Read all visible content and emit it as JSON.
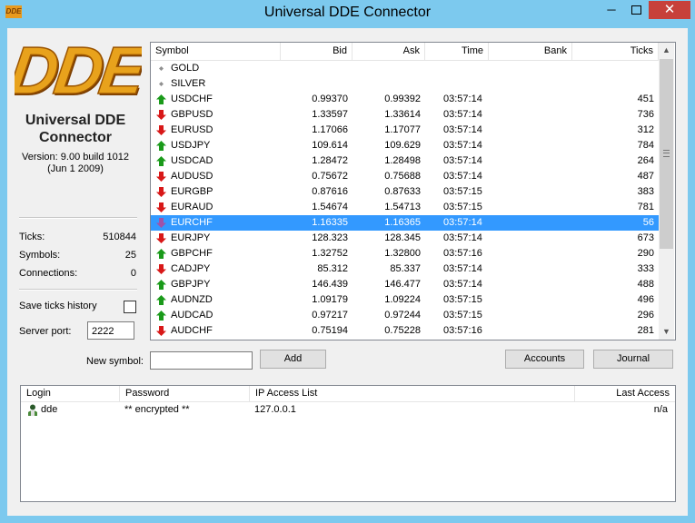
{
  "window": {
    "title": "Universal DDE Connector",
    "icon_text": "DDE",
    "min": "─",
    "close": "✕"
  },
  "logo": {
    "text": "DDE",
    "color": "#e8a21c"
  },
  "app": {
    "name_line1": "Universal DDE",
    "name_line2": "Connector",
    "version_line1": "Version: 9.00 build 1012",
    "version_line2": "(Jun  1 2009)"
  },
  "stats": {
    "ticks_label": "Ticks:",
    "ticks_value": "510844",
    "symbols_label": "Symbols:",
    "symbols_value": "25",
    "connections_label": "Connections:",
    "connections_value": "0"
  },
  "settings": {
    "save_history_label": "Save ticks history",
    "server_port_label": "Server port:",
    "server_port_value": "2222"
  },
  "symbols_table": {
    "columns": [
      "Symbol",
      "Bid",
      "Ask",
      "Time",
      "Bank",
      "Ticks"
    ],
    "rows": [
      {
        "dir": "none",
        "symbol": "GOLD",
        "bid": "",
        "ask": "",
        "time": "",
        "bank": "",
        "ticks": ""
      },
      {
        "dir": "none",
        "symbol": "SILVER",
        "bid": "",
        "ask": "",
        "time": "",
        "bank": "",
        "ticks": ""
      },
      {
        "dir": "up",
        "symbol": "USDCHF",
        "bid": "0.99370",
        "ask": "0.99392",
        "time": "03:57:14",
        "bank": "",
        "ticks": "451"
      },
      {
        "dir": "down",
        "symbol": "GBPUSD",
        "bid": "1.33597",
        "ask": "1.33614",
        "time": "03:57:14",
        "bank": "",
        "ticks": "736"
      },
      {
        "dir": "down",
        "symbol": "EURUSD",
        "bid": "1.17066",
        "ask": "1.17077",
        "time": "03:57:14",
        "bank": "",
        "ticks": "312"
      },
      {
        "dir": "up",
        "symbol": "USDJPY",
        "bid": "109.614",
        "ask": "109.629",
        "time": "03:57:14",
        "bank": "",
        "ticks": "784"
      },
      {
        "dir": "up",
        "symbol": "USDCAD",
        "bid": "1.28472",
        "ask": "1.28498",
        "time": "03:57:14",
        "bank": "",
        "ticks": "264"
      },
      {
        "dir": "down",
        "symbol": "AUDUSD",
        "bid": "0.75672",
        "ask": "0.75688",
        "time": "03:57:14",
        "bank": "",
        "ticks": "487"
      },
      {
        "dir": "down",
        "symbol": "EURGBP",
        "bid": "0.87616",
        "ask": "0.87633",
        "time": "03:57:15",
        "bank": "",
        "ticks": "383"
      },
      {
        "dir": "down",
        "symbol": "EURAUD",
        "bid": "1.54674",
        "ask": "1.54713",
        "time": "03:57:15",
        "bank": "",
        "ticks": "781"
      },
      {
        "dir": "down-sel",
        "symbol": "EURCHF",
        "bid": "1.16335",
        "ask": "1.16365",
        "time": "03:57:14",
        "bank": "",
        "ticks": "56",
        "selected": true
      },
      {
        "dir": "down",
        "symbol": "EURJPY",
        "bid": "128.323",
        "ask": "128.345",
        "time": "03:57:14",
        "bank": "",
        "ticks": "673"
      },
      {
        "dir": "up",
        "symbol": "GBPCHF",
        "bid": "1.32752",
        "ask": "1.32800",
        "time": "03:57:16",
        "bank": "",
        "ticks": "290"
      },
      {
        "dir": "down",
        "symbol": "CADJPY",
        "bid": "85.312",
        "ask": "85.337",
        "time": "03:57:14",
        "bank": "",
        "ticks": "333"
      },
      {
        "dir": "up",
        "symbol": "GBPJPY",
        "bid": "146.439",
        "ask": "146.477",
        "time": "03:57:14",
        "bank": "",
        "ticks": "488"
      },
      {
        "dir": "up",
        "symbol": "AUDNZD",
        "bid": "1.09179",
        "ask": "1.09224",
        "time": "03:57:15",
        "bank": "",
        "ticks": "496"
      },
      {
        "dir": "up",
        "symbol": "AUDCAD",
        "bid": "0.97217",
        "ask": "0.97244",
        "time": "03:57:15",
        "bank": "",
        "ticks": "296"
      },
      {
        "dir": "down",
        "symbol": "AUDCHF",
        "bid": "0.75194",
        "ask": "0.75228",
        "time": "03:57:16",
        "bank": "",
        "ticks": "281"
      }
    ]
  },
  "actions": {
    "new_symbol_label": "New symbol:",
    "add": "Add",
    "accounts": "Accounts",
    "journal": "Journal"
  },
  "accounts_table": {
    "columns": [
      "Login",
      "Password",
      "IP Access List",
      "Last Access"
    ],
    "rows": [
      {
        "login": "dde",
        "password": "** encrypted **",
        "ip": "127.0.0.1",
        "last": "n/a"
      }
    ]
  },
  "colors": {
    "up": "#1a9a1a",
    "down": "#d81818",
    "selected": "#3399ff"
  }
}
